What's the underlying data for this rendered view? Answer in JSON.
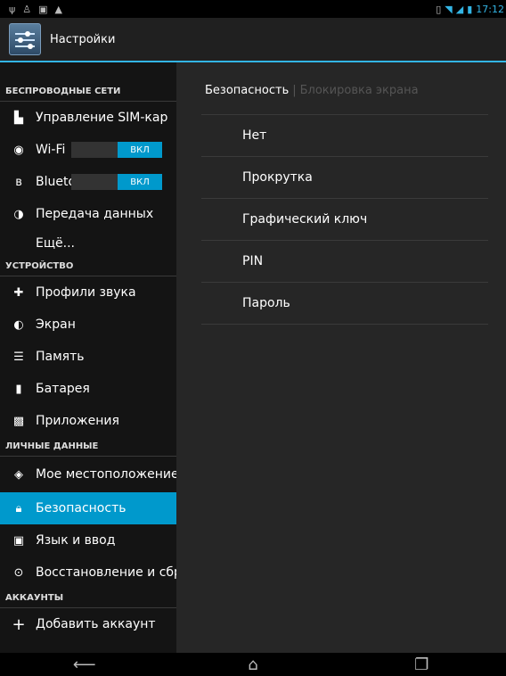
{
  "status_bar": {
    "time": "17:12",
    "left_icons": [
      "usb-icon",
      "debug-icon",
      "image-icon",
      "warning-icon"
    ],
    "right_icons": [
      "vibrate-icon",
      "wifi-icon",
      "signal-icon",
      "battery-icon"
    ]
  },
  "action_bar": {
    "title": "Настройки"
  },
  "sidebar": {
    "sections": [
      {
        "header": "БЕСПРОВОДНЫЕ СЕТИ",
        "items": [
          {
            "label": "Управление SIM-кар",
            "icon": "sim-icon"
          },
          {
            "label": "Wi-Fi",
            "icon": "wifi-icon",
            "toggle": "ВКЛ"
          },
          {
            "label": "Bluetooth",
            "icon": "bluetooth-icon",
            "toggle": "ВКЛ"
          },
          {
            "label": "Передача данных",
            "icon": "data-usage-icon"
          },
          {
            "label": "Ещё...",
            "icon": ""
          }
        ]
      },
      {
        "header": "УСТРОЙСТВО",
        "items": [
          {
            "label": "Профили звука",
            "icon": "sound-profile-icon"
          },
          {
            "label": "Экран",
            "icon": "display-icon"
          },
          {
            "label": "Память",
            "icon": "storage-icon"
          },
          {
            "label": "Батарея",
            "icon": "battery-icon"
          },
          {
            "label": "Приложения",
            "icon": "apps-icon"
          }
        ]
      },
      {
        "header": "ЛИЧНЫЕ ДАННЫЕ",
        "items": [
          {
            "label": "Мое местоположение",
            "icon": "location-icon"
          },
          {
            "label": "Безопасность",
            "icon": "lock-icon",
            "selected": true
          },
          {
            "label": "Язык и ввод",
            "icon": "language-icon"
          },
          {
            "label": "Восстановление и сброс",
            "icon": "restore-icon"
          }
        ]
      },
      {
        "header": "АККАУНТЫ",
        "items": [
          {
            "label": "Добавить аккаунт",
            "icon": "add-icon"
          }
        ]
      }
    ]
  },
  "main": {
    "breadcrumb": {
      "current": "Безопасность",
      "parent": "Блокировка экрана"
    },
    "options": [
      "Нет",
      "Прокрутка",
      "Графический ключ",
      "PIN",
      "Пароль"
    ]
  },
  "nav_bar": {
    "buttons": [
      "back-icon",
      "home-icon",
      "recents-icon"
    ]
  }
}
